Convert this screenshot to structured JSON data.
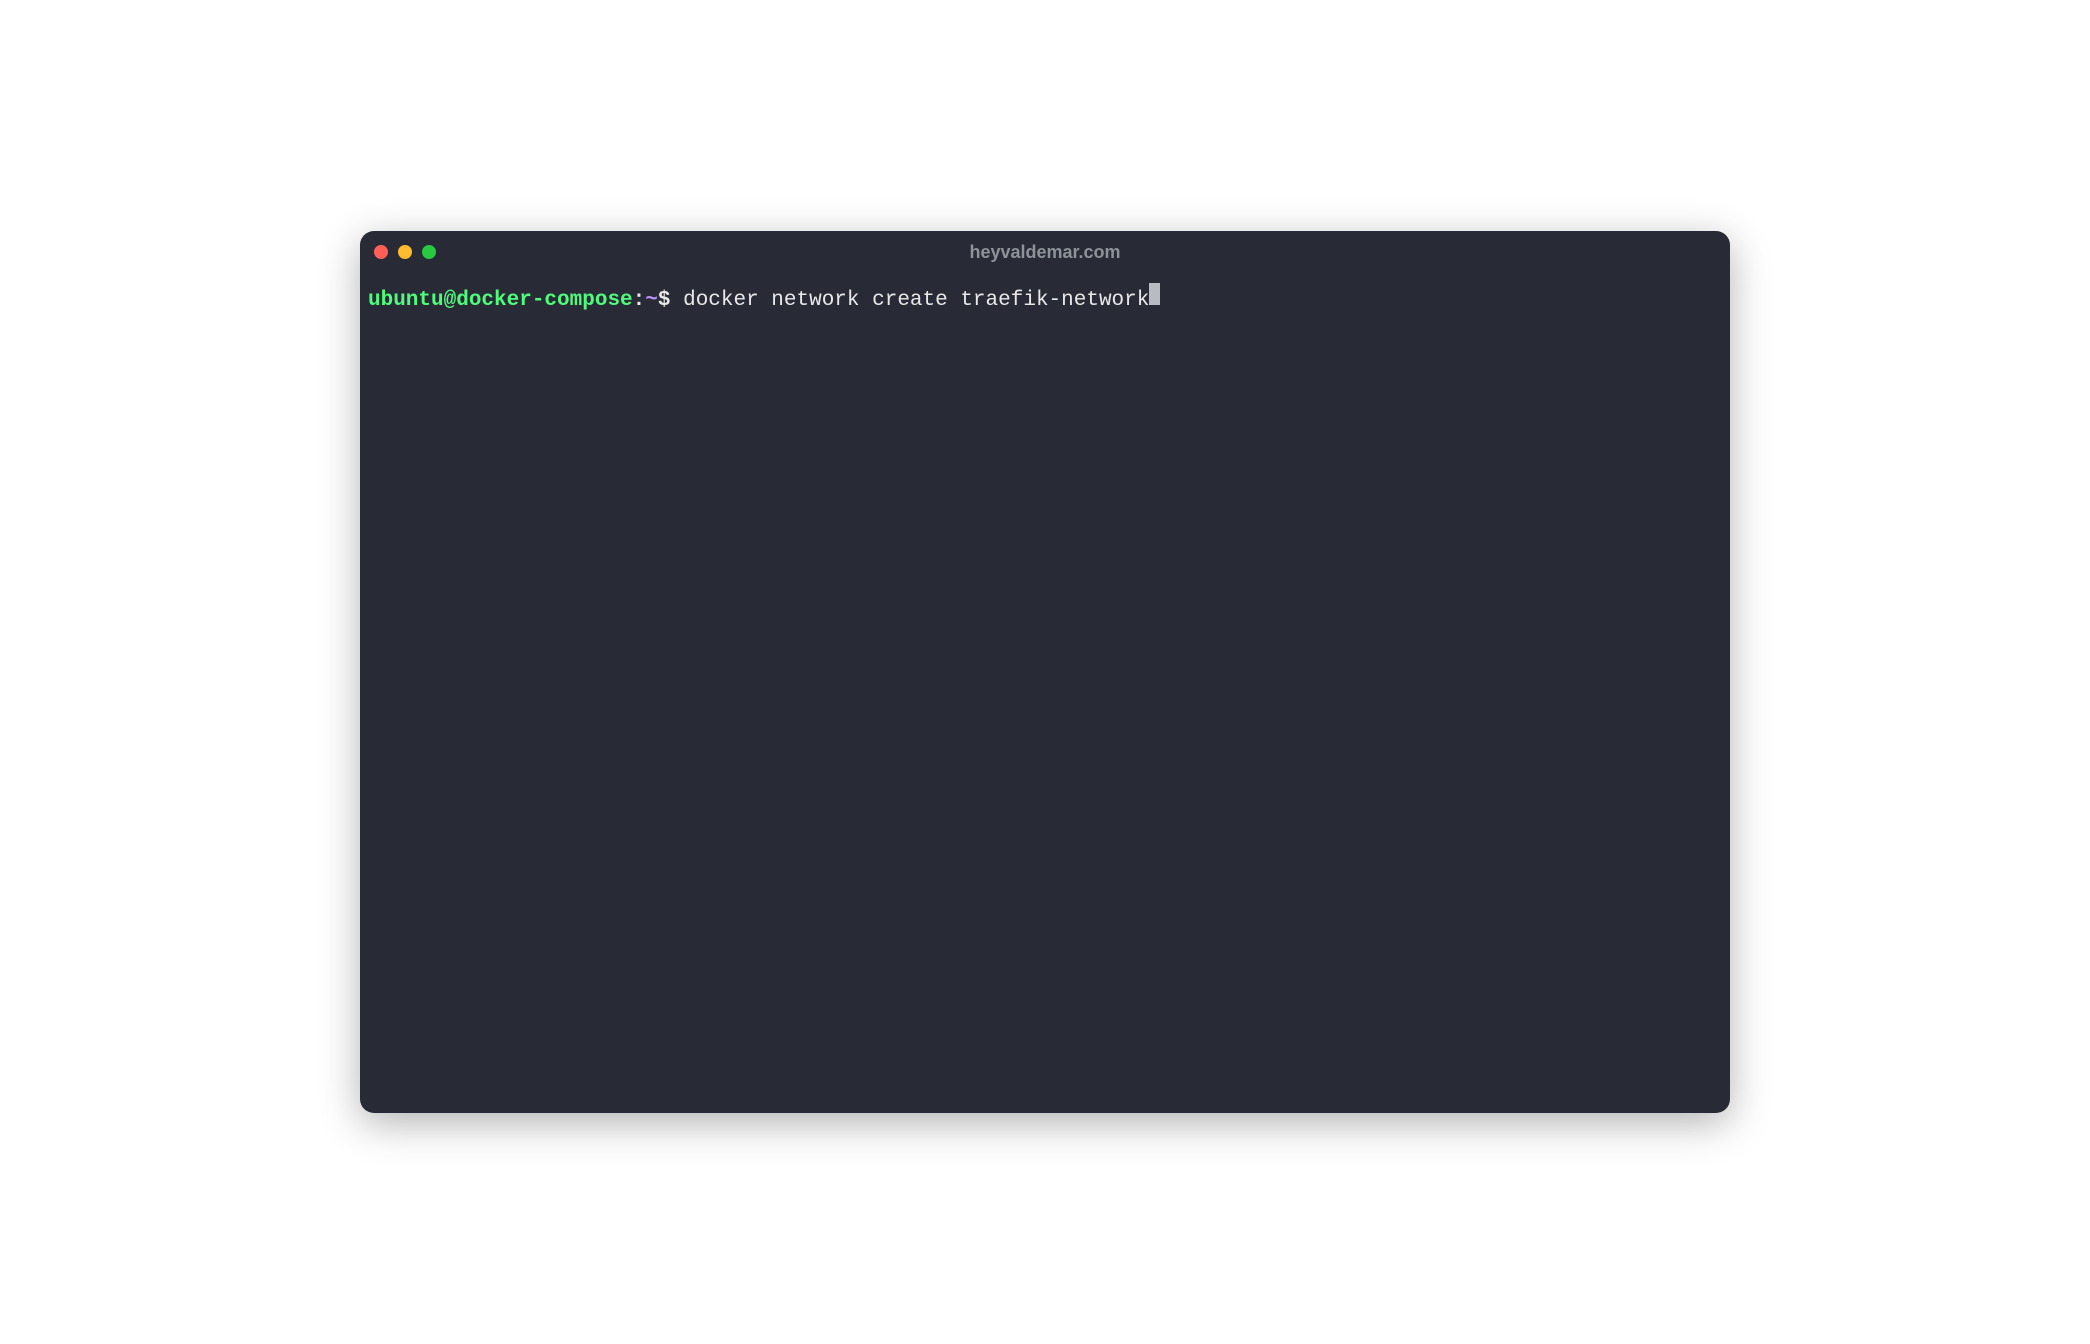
{
  "window": {
    "title": "heyvaldemar.com"
  },
  "prompt": {
    "user_host": "ubuntu@docker-compose",
    "separator": ":",
    "path": "~",
    "symbol": "$"
  },
  "command": " docker network create traefik-network",
  "colors": {
    "background": "#282a36",
    "user_host": "#50fa7b",
    "path": "#bd93f9",
    "text": "#e8e8e8",
    "cursor": "#b8bbc2",
    "title": "#8e9299",
    "close": "#ff5f57",
    "minimize": "#febc2e",
    "maximize": "#28c840"
  }
}
